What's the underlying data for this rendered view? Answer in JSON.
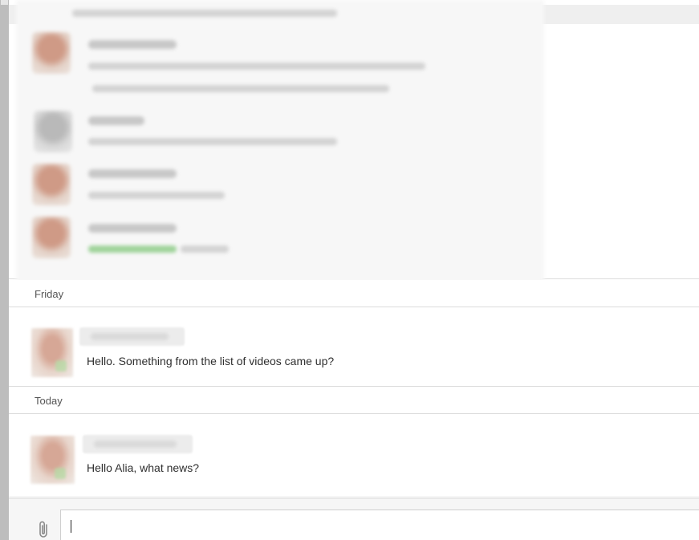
{
  "history": {
    "visible": "blurred"
  },
  "separators": {
    "friday": "Friday",
    "today": "Today"
  },
  "messages": [
    {
      "sender_name": "",
      "text": "Hello. Something from the list of videos came up?"
    },
    {
      "sender_name": "",
      "text": "Hello Alia, what news?"
    }
  ],
  "composer": {
    "value": "",
    "placeholder": "",
    "attach_icon": "paperclip-icon"
  },
  "colors": {
    "separator_line": "#dcdcdc",
    "composer_bg": "#f6f6f6",
    "text": "#2f2f2f",
    "online_green": "#9fd39a"
  }
}
